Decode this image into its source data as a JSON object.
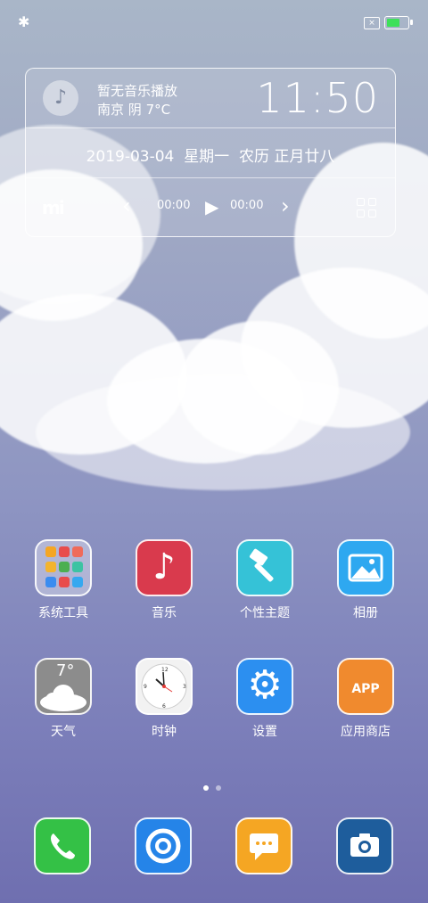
{
  "status_bar": {
    "bluetooth_icon": "bluetooth-icon",
    "sim_icon": "sim-error-icon",
    "battery_level": 0.55,
    "battery_color": "#3ee05a"
  },
  "widget": {
    "music_status": "暂无音乐播放",
    "location": "南京",
    "weather": "阴",
    "temperature": "7°C",
    "time": "11:50",
    "date": "2019-03-04",
    "weekday": "星期一",
    "lunar": "农历 正月廿八",
    "elapsed": "00:00",
    "duration": "00:00"
  },
  "apps": {
    "row1": [
      {
        "label": "系统工具",
        "icon": "folder-icon"
      },
      {
        "label": "音乐",
        "icon": "music-note-icon"
      },
      {
        "label": "个性主题",
        "icon": "paintbrush-icon"
      },
      {
        "label": "相册",
        "icon": "photo-icon"
      }
    ],
    "row2": [
      {
        "label": "天气",
        "icon": "weather-icon",
        "temp": "7°"
      },
      {
        "label": "时钟",
        "icon": "clock-icon"
      },
      {
        "label": "设置",
        "icon": "gear-icon"
      },
      {
        "label": "应用商店",
        "icon": "app-store-icon",
        "badge": "APP"
      }
    ]
  },
  "page_indicator": {
    "current": 1,
    "total": 2
  },
  "dock": [
    {
      "icon": "phone-icon"
    },
    {
      "icon": "browser-icon"
    },
    {
      "icon": "message-icon"
    },
    {
      "icon": "camera-icon"
    }
  ]
}
